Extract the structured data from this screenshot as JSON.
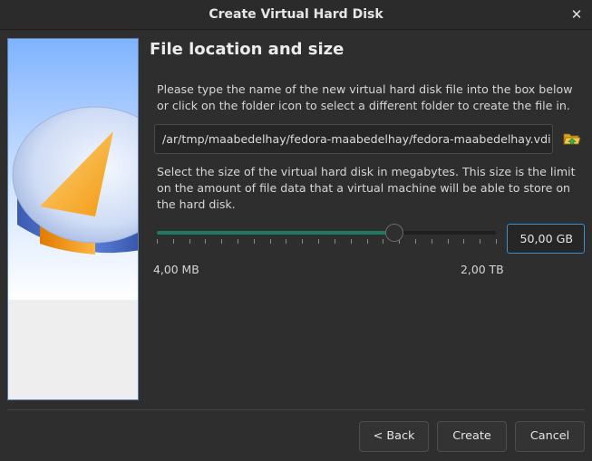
{
  "window": {
    "title": "Create Virtual Hard Disk",
    "close_icon": "close-icon"
  },
  "page": {
    "heading": "File location and size",
    "location_description": "Please type the name of the new virtual hard disk file into the box below or click on the folder icon to select a different folder to create the file in.",
    "size_description": "Select the size of the virtual hard disk in megabytes. This size is the limit on the amount of file data that a virtual machine will be able to store on the hard disk."
  },
  "location": {
    "path_value": "/ar/tmp/maabedelhay/fedora-maabedelhay/fedora-maabedelhay.vdi",
    "folder_icon": "folder-open-icon"
  },
  "size": {
    "slider_fraction": 0.7,
    "value_text": "50,00 GB",
    "min_label": "4,00 MB",
    "max_label": "2,00 TB"
  },
  "buttons": {
    "back": "< Back",
    "create": "Create",
    "cancel": "Cancel"
  },
  "colors": {
    "accent_fill": "#1f7a63",
    "focus_border": "#3d8ec9",
    "background": "#2e2e2e"
  }
}
